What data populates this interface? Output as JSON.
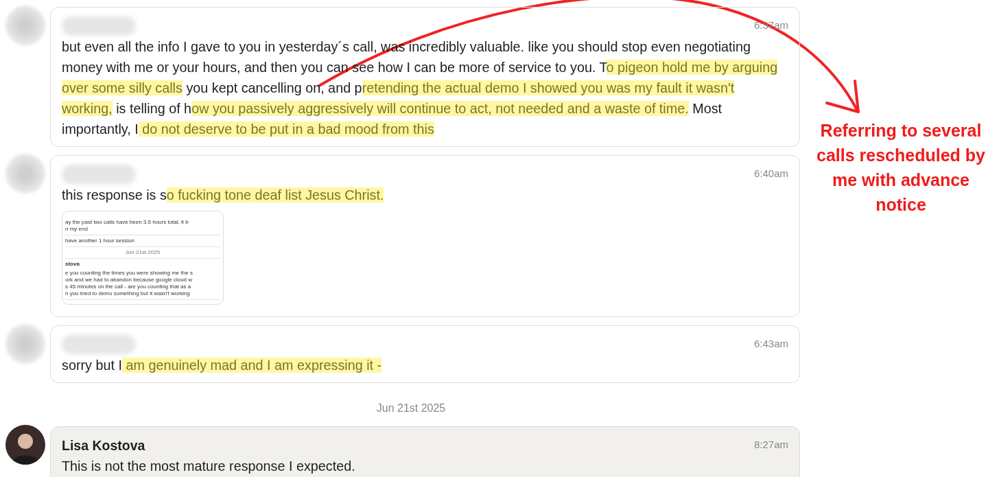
{
  "items": [
    {
      "kind": "message",
      "avatar": {
        "kind": "blurred"
      },
      "tinted": false,
      "time": "6:37am",
      "segments": [
        {
          "text": "but even all the info I gave to you in yesterday´s call, was incredibly valuable. like you should stop even negotiating money with me or your hours, and then you can see how I can be more of service to you. T",
          "highlighted": false
        },
        {
          "text": "o pigeon hold me by arguing over some silly calls",
          "highlighted": true
        },
        {
          "text": " you kept cancelling on, and p",
          "highlighted": false
        },
        {
          "text": "retending the actual demo I showed you was my fault it wasn't working,",
          "highlighted": true
        },
        {
          "text": " is telling of h",
          "highlighted": false
        },
        {
          "text": "ow you passively aggressively will continue to act, not needed and a waste of time.",
          "highlighted": true
        },
        {
          "text": " Most importantly, I",
          "highlighted": false
        },
        {
          "text": " do not deserve to be put in a bad mood from this",
          "highlighted": true
        }
      ]
    },
    {
      "kind": "message",
      "avatar": {
        "kind": "blurred"
      },
      "tinted": false,
      "time": "6:40am",
      "segments": [
        {
          "text": "this response is s",
          "highlighted": false
        },
        {
          "text": "o fucking tone deaf list Jesus Christ.",
          "highlighted": true
        }
      ],
      "attachment": {
        "blocks": [
          {
            "kind": "text",
            "lines": [
              "ay the past two calls have been 3.5 hours total, it b",
              "n my end"
            ]
          },
          {
            "kind": "text",
            "lines": [
              "have another 1 hour session"
            ]
          },
          {
            "kind": "date",
            "lines": [
              "Jun 21st 2025"
            ]
          },
          {
            "kind": "name",
            "lines": [
              "stova"
            ]
          },
          {
            "kind": "text",
            "lines": [
              "e you counting the times you were showing me the s",
              "ork and we had to abandon because google cloud w",
              "s 45 minutes on the call - are you counting that as a",
              "n you tried to demo something but it wasn't working"
            ]
          }
        ]
      }
    },
    {
      "kind": "message",
      "avatar": {
        "kind": "blurred"
      },
      "tinted": false,
      "time": "6:43am",
      "segments": [
        {
          "text": "sorry but I",
          "highlighted": false
        },
        {
          "text": " am genuinely mad and I am expressing it -",
          "highlighted": true
        }
      ]
    },
    {
      "kind": "date",
      "label": "Jun 21st 2025"
    },
    {
      "kind": "message",
      "avatar": {
        "kind": "photo"
      },
      "tinted": true,
      "author": "Lisa Kostova",
      "time": "8:27am",
      "segments": [
        {
          "text": "This is not the most mature response I expected.",
          "highlighted": false
        }
      ]
    }
  ],
  "annotation": {
    "text": "Referring to several calls rescheduled by me with advance notice"
  }
}
